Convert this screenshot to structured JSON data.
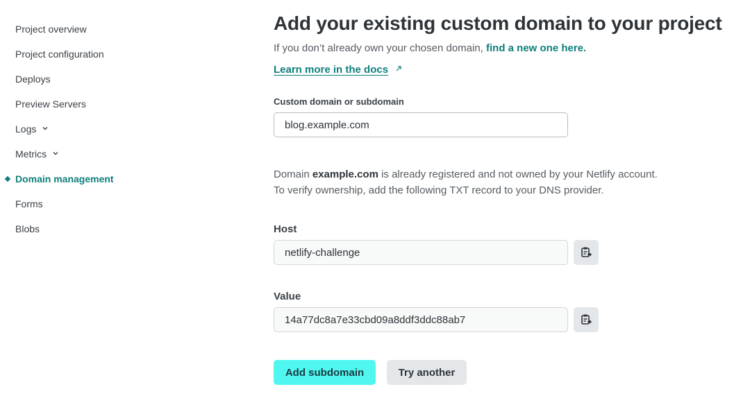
{
  "sidebar": {
    "items": [
      {
        "label": "Project overview"
      },
      {
        "label": "Project configuration"
      },
      {
        "label": "Deploys"
      },
      {
        "label": "Preview Servers"
      },
      {
        "label": "Logs"
      },
      {
        "label": "Metrics"
      },
      {
        "label": "Domain management"
      },
      {
        "label": "Forms"
      },
      {
        "label": "Blobs"
      }
    ]
  },
  "main": {
    "title": "Add your existing custom domain to your project",
    "subtitle_prefix": "If you don’t already own your chosen domain, ",
    "subtitle_link": "find a new one here.",
    "docs_link": "Learn more in the docs",
    "domain_field": {
      "label": "Custom domain or subdomain",
      "value": "blog.example.com"
    },
    "info": {
      "line1_prefix": "Domain ",
      "line1_domain": "example.com",
      "line1_suffix": " is already registered and not owned by your Netlify account.",
      "line2": "To verify ownership, add the following TXT record to your DNS provider."
    },
    "host": {
      "label": "Host",
      "value": "netlify-challenge"
    },
    "value": {
      "label": "Value",
      "value": "14a77dc8a7e33cbd09a8ddf3ddc88ab7"
    },
    "buttons": {
      "primary": "Add subdomain",
      "secondary": "Try another"
    }
  },
  "colors": {
    "accent": "#0e7f7b",
    "primary_button": "#4ff7f0",
    "secondary_button": "#e4e7ea",
    "text": "#2e3338"
  },
  "icons": [
    "chevron-down-icon",
    "external-link-icon",
    "copy-clipboard-icon",
    "active-diamond-icon"
  ]
}
